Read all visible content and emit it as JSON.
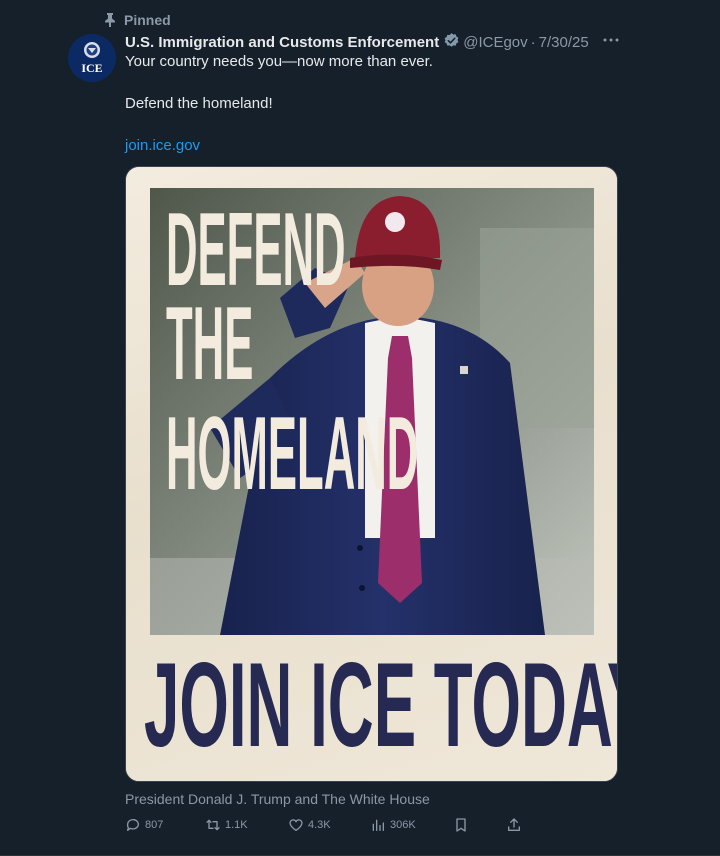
{
  "pinned": {
    "label": "Pinned",
    "icon": "pin-icon"
  },
  "author": {
    "display_name": "U.S. Immigration and Customs Enforcement",
    "handle": "@ICEgov",
    "separator": "·",
    "date": "7/30/25",
    "verified_icon": "verified-badge-icon",
    "avatar_text": "ICE"
  },
  "body": {
    "line1": "Your country needs you—now more than ever.",
    "line2": "Defend the homeland!",
    "link": "join.ice.gov"
  },
  "media": {
    "headline_words": [
      "DEFEND",
      "THE",
      "HOMELAND"
    ],
    "footer_text": "JOIN ICE TODAY",
    "paper_color": "#eee6d7",
    "headline_color": "#f2ebde",
    "footer_color": "#262a52",
    "hat_color": "#8b1e2e",
    "suit_color": "#1e2a5c",
    "tie_color": "#9c2f6b"
  },
  "caption": "President Donald J. Trump and The White House",
  "actions": [
    {
      "icon": "reply-icon",
      "count": "807"
    },
    {
      "icon": "repost-icon",
      "count": "1.1K"
    },
    {
      "icon": "like-icon",
      "count": "4.3K"
    },
    {
      "icon": "views-icon",
      "count": "306K"
    },
    {
      "icon": "bookmark-icon",
      "count": ""
    },
    {
      "icon": "share-icon",
      "count": ""
    }
  ],
  "colors": {
    "background": "#15202b",
    "text": "#e7e9ea",
    "secondary": "#8b98a5",
    "link": "#1d9bf0"
  }
}
